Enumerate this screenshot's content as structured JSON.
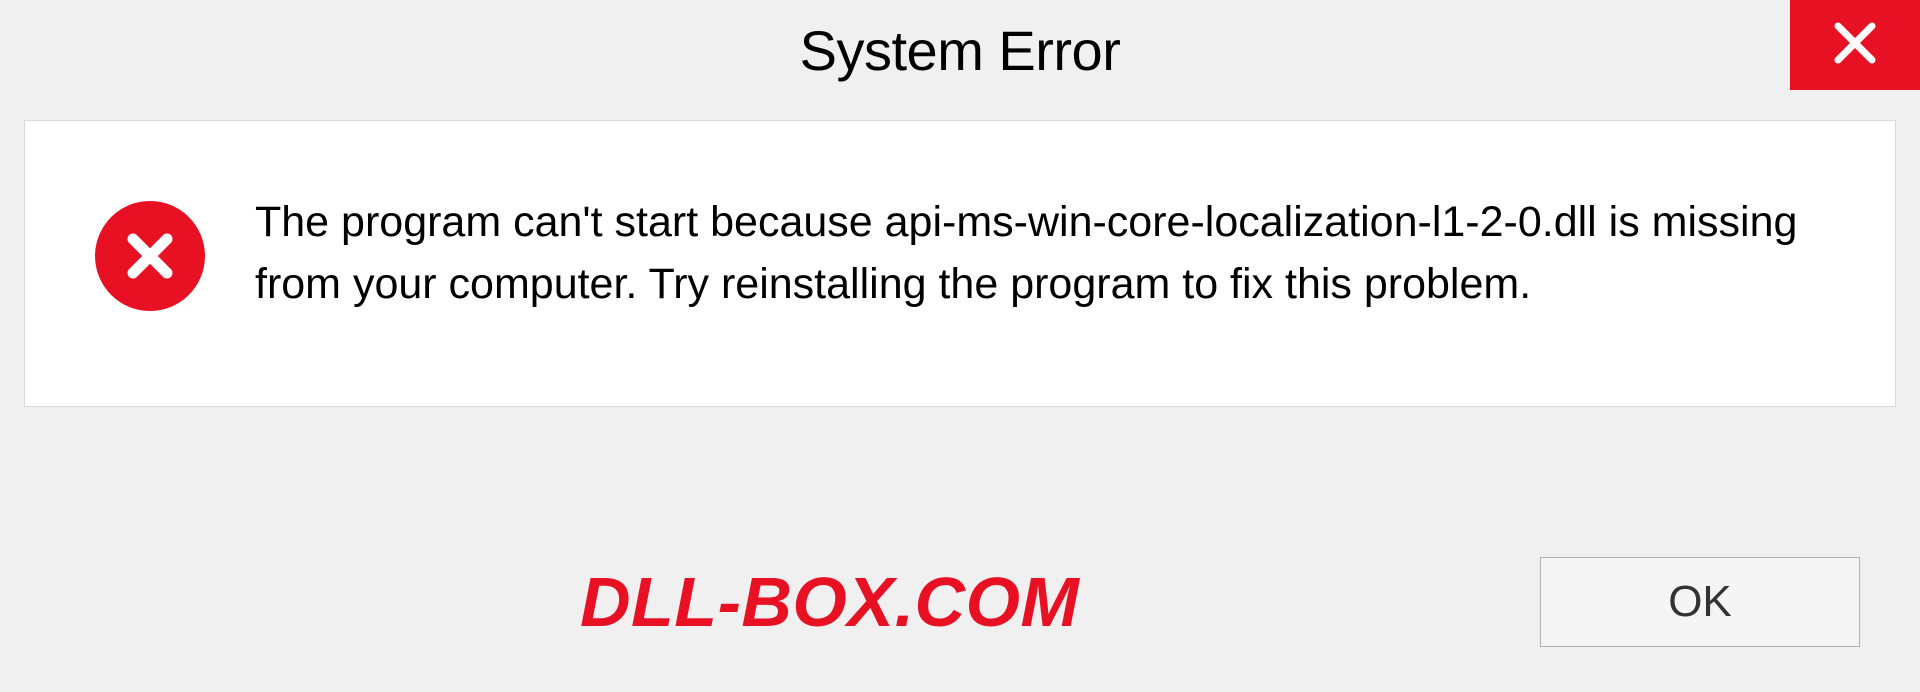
{
  "dialog": {
    "title": "System Error",
    "message": "The program can't start because api-ms-win-core-localization-l1-2-0.dll is missing from your computer. Try reinstalling the program to fix this problem.",
    "ok_label": "OK"
  },
  "watermark": "DLL-BOX.COM",
  "colors": {
    "error_red": "#e81123",
    "background": "#f0f0f0",
    "content_bg": "#ffffff"
  }
}
